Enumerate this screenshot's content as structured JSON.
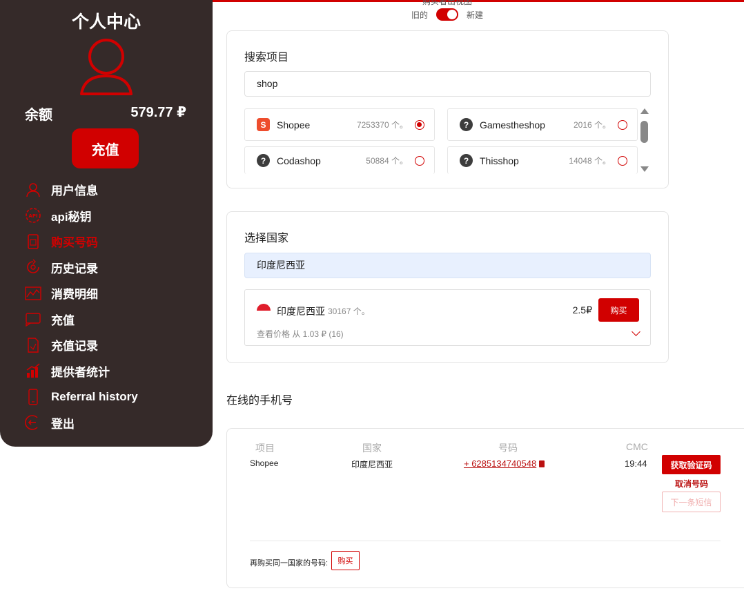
{
  "sidebar": {
    "title": "个人中心",
    "balance_label": "余额",
    "balance_value": "579.77 ₽",
    "topup_label": "充值",
    "menu": [
      {
        "label": "用户信息",
        "icon": "user-icon"
      },
      {
        "label": "api秘钥",
        "icon": "api-icon"
      },
      {
        "label": "购买号码",
        "icon": "sim-card-icon"
      },
      {
        "label": "历史记录",
        "icon": "history-icon"
      },
      {
        "label": "消费明细",
        "icon": "chart-line-icon"
      },
      {
        "label": "充值",
        "icon": "wallet-icon"
      },
      {
        "label": "充值记录",
        "icon": "document-icon"
      },
      {
        "label": "提供者统计",
        "icon": "bar-chart-icon"
      },
      {
        "label": "Referral history",
        "icon": "phone-icon"
      },
      {
        "label": "登出",
        "icon": "logout-icon"
      }
    ],
    "active_index": 2,
    "accent": "#d10000",
    "bg": "#352a29"
  },
  "toggle": {
    "top_text": "购买者出视图",
    "left_label": "旧的",
    "right_label": "新建",
    "state": "new"
  },
  "service_card": {
    "title": "搜索项目",
    "search_value": "shop",
    "items": [
      {
        "name": "Shopee",
        "count": "7253370 个。",
        "logo": "S",
        "selected": true
      },
      {
        "name": "Gamestheshop",
        "count": "2016 个。",
        "logo": "?",
        "selected": false
      },
      {
        "name": "Codashop",
        "count": "50884 个。",
        "logo": "?",
        "selected": false
      },
      {
        "name": "Thisshop",
        "count": "14048 个。",
        "logo": "?",
        "selected": false
      }
    ]
  },
  "country_card": {
    "title": "选择国家",
    "search_value": "印度尼西亚",
    "country": "印度尼西亚",
    "count": "30167 个。",
    "price": "2.5₽",
    "buy_label": "购买",
    "price_note": "查看价格 从 1.03 ₽ (16)"
  },
  "online": {
    "title": "在线的手机号",
    "headers": [
      "项目",
      "国家",
      "号码",
      "CMC"
    ],
    "row": {
      "service": "Shopee",
      "country": "印度尼西亚",
      "number": "+ 6285134740548",
      "time": "19:44"
    },
    "get_code_label": "获取验证码",
    "cancel_label": "取消号码",
    "next_sms_label": "下一条短信",
    "rebuy_label": "再购买同一国家的号码:",
    "rebuy_btn": "购买"
  }
}
